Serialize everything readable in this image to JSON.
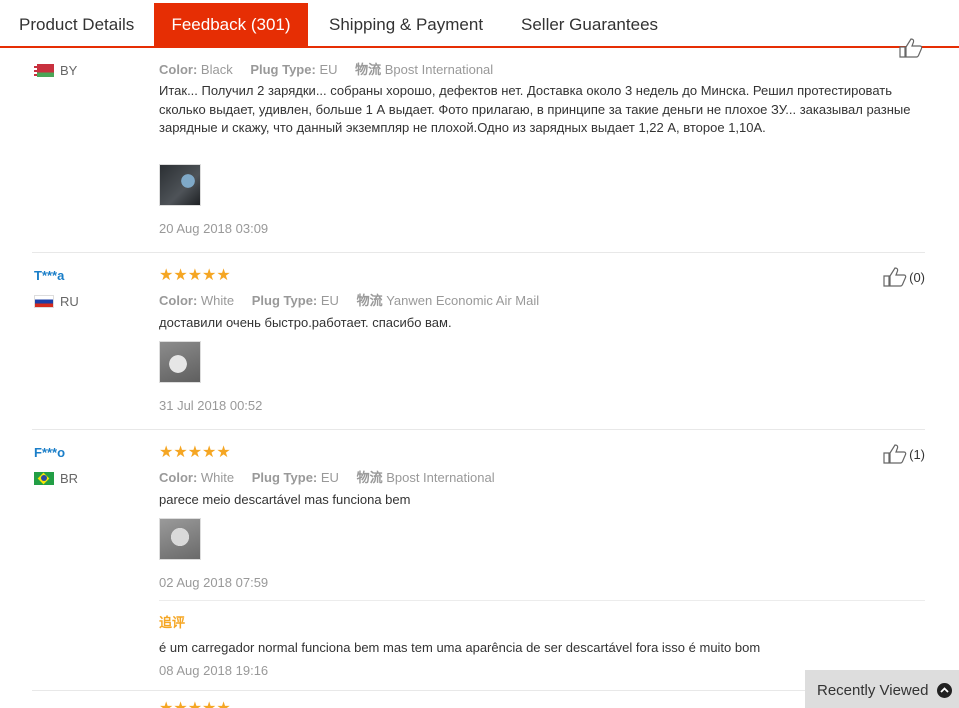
{
  "tabs": [
    {
      "label": "Product Details",
      "active": false
    },
    {
      "label": "Feedback (301)",
      "active": true
    },
    {
      "label": "Shipping & Payment",
      "active": false
    },
    {
      "label": "Seller Guarantees",
      "active": false
    }
  ],
  "attr_labels": {
    "color": "Color:",
    "plug": "Plug Type:",
    "shipping": "物流"
  },
  "reviews": [
    {
      "user": "",
      "country": "BY",
      "color": "Black",
      "plug": "EU",
      "shipping": "Bpost International",
      "text": "Итак... Получил 2 зарядки... собраны хорошо, дефектов нет. Доставка около 3 недель до Минска. Решил протестировать сколько выдает, удивлен, больше 1 А выдает. Фото прилагаю, в принципе за такие деньги не плохое ЗУ... заказывал разные зарядные и скажу, что данный экземпляр не плохой.Одно из зарядных выдает 1,22 А, второе 1,10А.",
      "date": "20 Aug 2018 03:09"
    },
    {
      "user": "T***a",
      "country": "RU",
      "stars": "★★★★★",
      "color": "White",
      "plug": "EU",
      "shipping": "Yanwen Economic Air Mail",
      "text": "доставили очень быстро.работает. спасибо вам.",
      "date": "31 Jul 2018 00:52",
      "helpful": "(0)"
    },
    {
      "user": "F***o",
      "country": "BR",
      "stars": "★★★★★",
      "color": "White",
      "plug": "EU",
      "shipping": "Bpost International",
      "text": "parece meio descartável mas funciona bem",
      "date": "02 Aug 2018 07:59",
      "helpful": "(1)",
      "followup": {
        "label": "追评",
        "text": "é um carregador normal funciona bem mas tem uma aparência de ser descartável fora isso é muito bom",
        "date": "08 Aug 2018 19:16"
      }
    }
  ],
  "recently_viewed": "Recently Viewed",
  "colors": {
    "accent": "#e62e04",
    "star": "#f5a623",
    "user": "#1a7ec8"
  }
}
